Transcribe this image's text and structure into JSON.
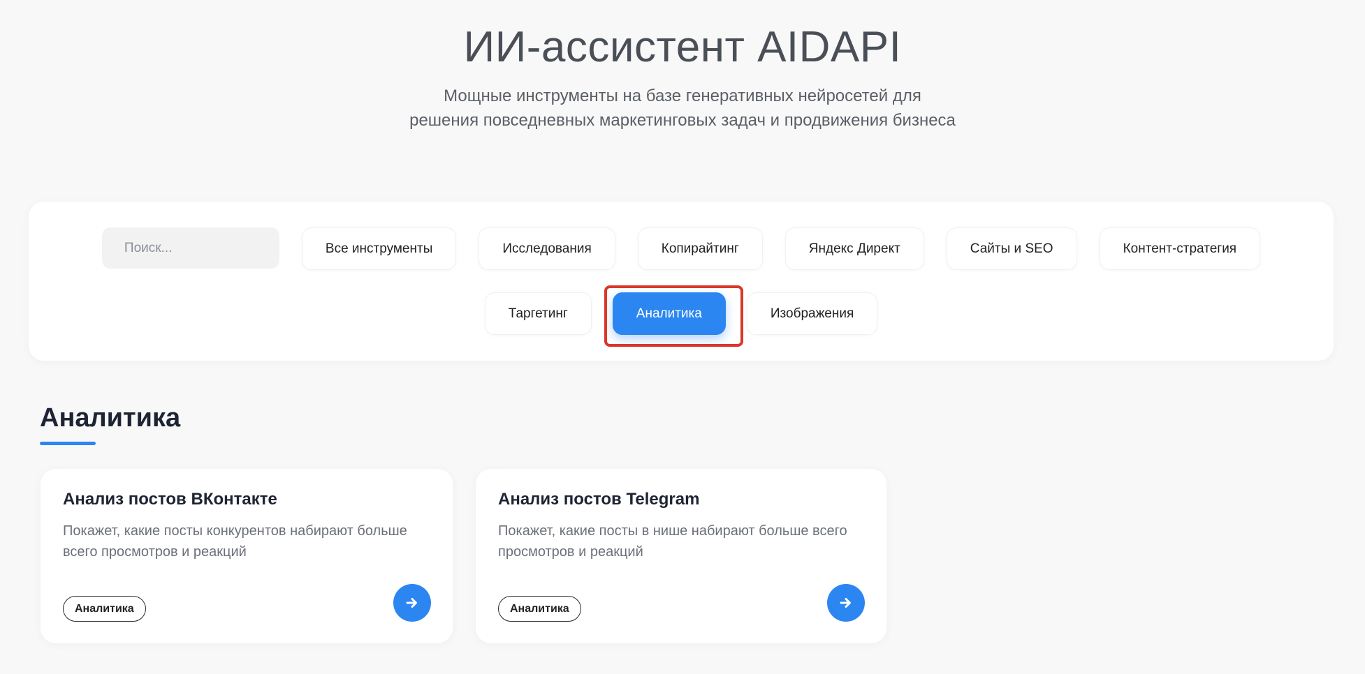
{
  "hero": {
    "title": "ИИ-ассистент AIDAPI",
    "subtitle_line1": "Мощные инструменты на базе генеративных нейросетей для",
    "subtitle_line2": "решения повседневных маркетинговых задач и продвижения бизнеса"
  },
  "search": {
    "placeholder": "Поиск...",
    "value": ""
  },
  "filters": [
    {
      "label": "Все инструменты",
      "active": false
    },
    {
      "label": "Исследования",
      "active": false
    },
    {
      "label": "Копирайтинг",
      "active": false
    },
    {
      "label": "Яндекс Директ",
      "active": false
    },
    {
      "label": "Сайты и SEO",
      "active": false
    },
    {
      "label": "Контент-стратегия",
      "active": false
    },
    {
      "label": "Таргетинг",
      "active": false
    },
    {
      "label": "Аналитика",
      "active": true
    },
    {
      "label": "Изображения",
      "active": false
    }
  ],
  "section": {
    "title": "Аналитика"
  },
  "cards": [
    {
      "title": "Анализ постов ВКонтакте",
      "description": "Покажет, какие посты конкурентов набирают больше всего просмотров и реакций",
      "tag": "Аналитика",
      "action_icon": "arrow-right-icon"
    },
    {
      "title": "Анализ постов Telegram",
      "description": "Покажет, какие посты в нише набирают больше всего просмотров и реакций",
      "tag": "Аналитика",
      "action_icon": "arrow-right-icon"
    }
  ],
  "colors": {
    "accent": "#2b86f1",
    "highlight": "#d9372a",
    "background": "#f8f8f8"
  }
}
